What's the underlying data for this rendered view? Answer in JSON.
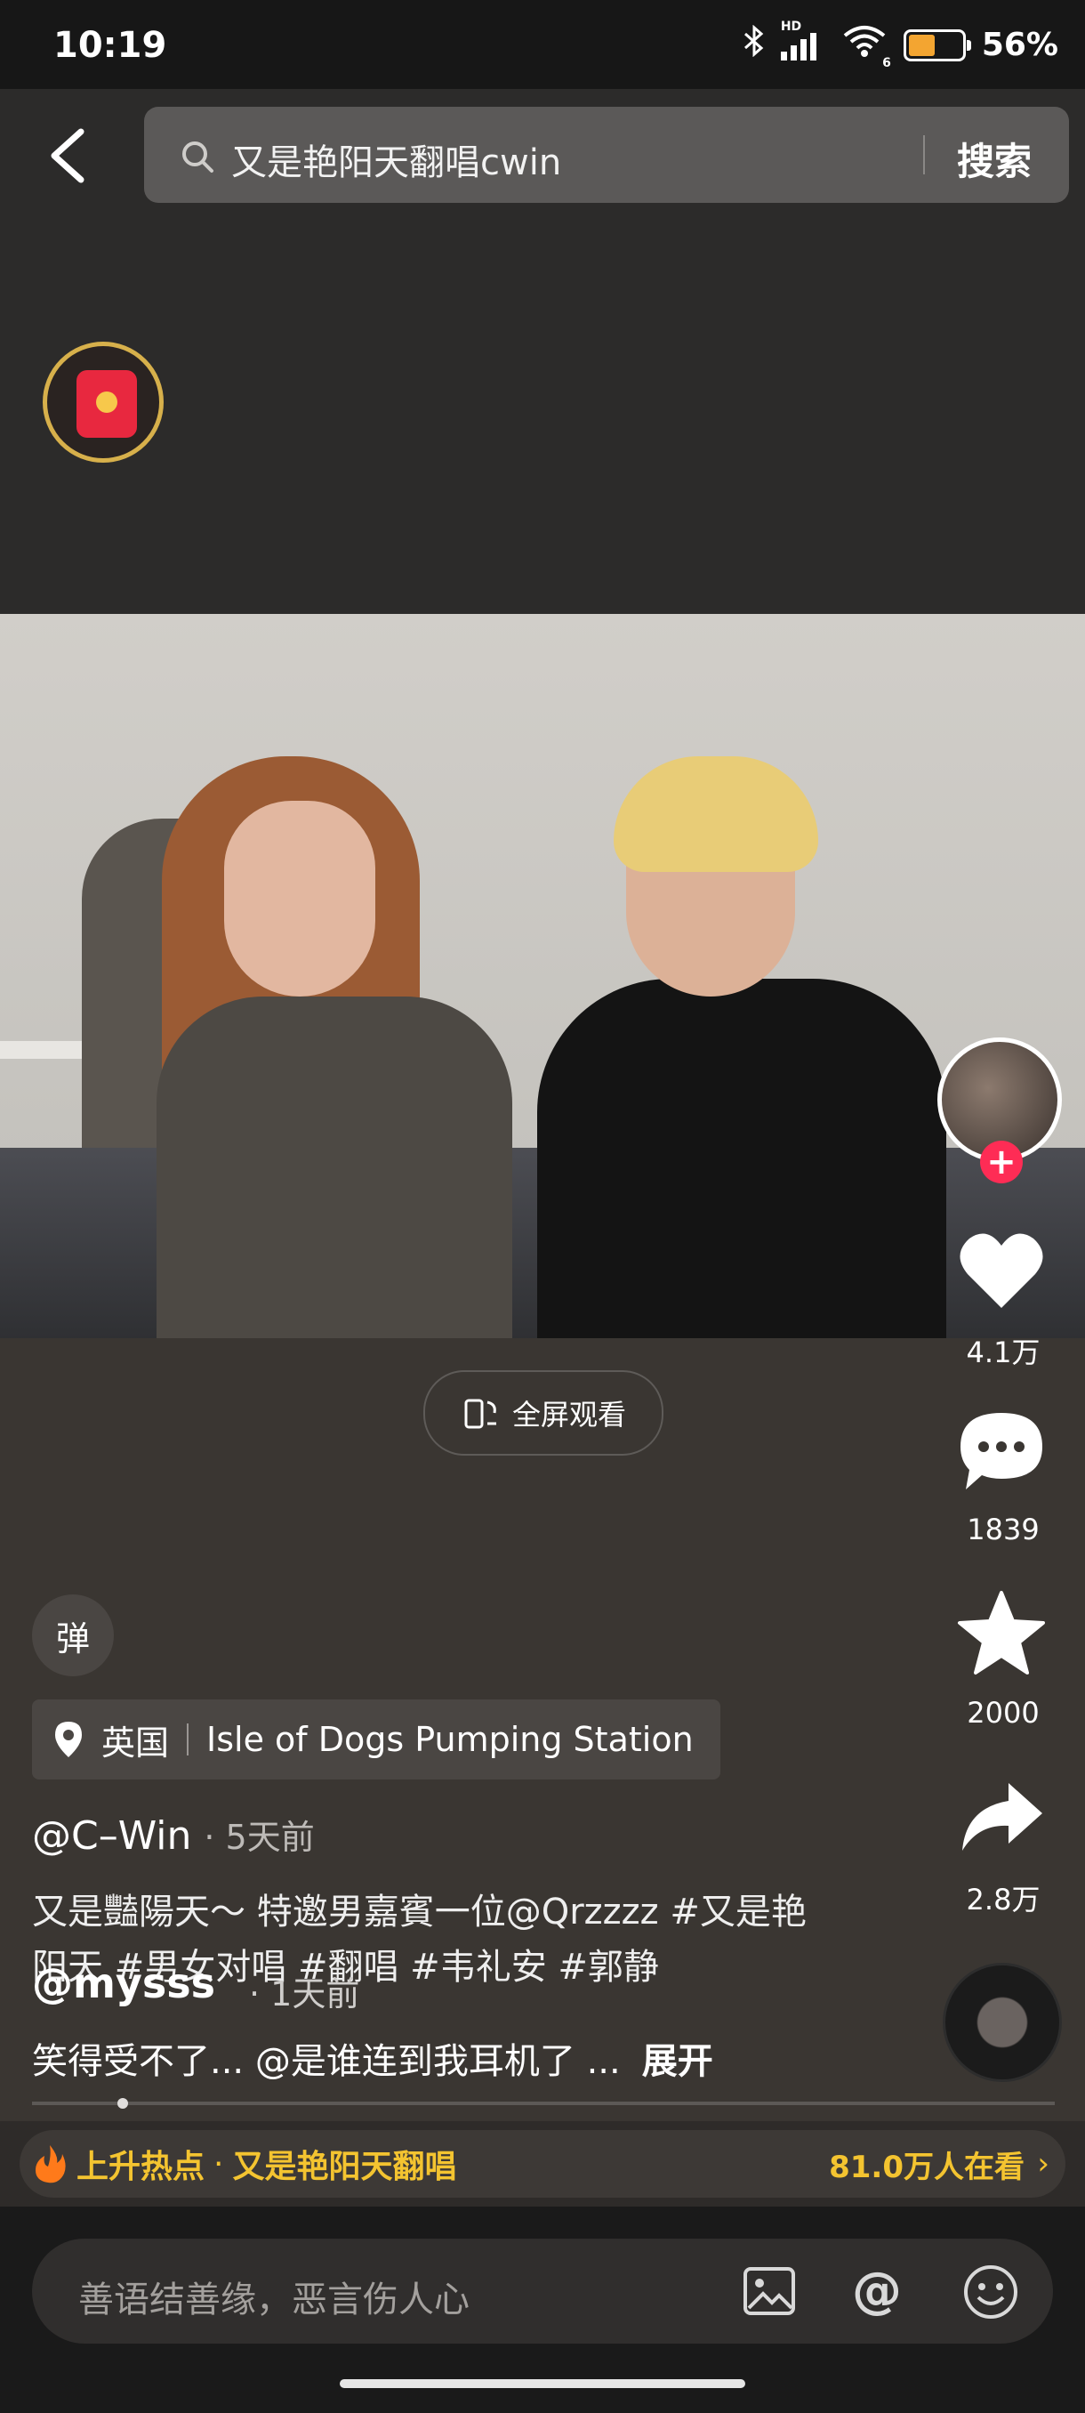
{
  "status_bar": {
    "time": "10:19",
    "network_label": "HD",
    "wifi_label": "6",
    "battery_percent": "56%",
    "battery_level": 0.56
  },
  "search": {
    "query": "又是艳阳天翻唱cwin",
    "button_label": "搜索"
  },
  "video": {
    "fullscreen_label": "全屏观看"
  },
  "actions": {
    "like_count": "4.1万",
    "comment_count": "1839",
    "favorite_count": "2000",
    "share_count": "2.8万"
  },
  "danmaku_label": "弹",
  "location": {
    "country": "英国",
    "place": "Isle of Dogs Pumping Station"
  },
  "post": {
    "author": "@C–Win",
    "time": "· 5天前",
    "caption": "又是豔陽天～ 特邀男嘉賓一位@Qrzzzz #又是艳阳天 #男女对唱 #翻唱 #韦礼安 #郭静"
  },
  "reply": {
    "user": "@mysss",
    "time": "· 1天前",
    "text": "笑得受不了... @是谁连到我耳机了 ...",
    "expand_label": "展开"
  },
  "hot": {
    "label": "上升热点",
    "dot": "·",
    "title": "又是艳阳天翻唱",
    "viewers": "81.0万人在看",
    "chevron": "›"
  },
  "comment_input": {
    "placeholder": "善语结善缘，恶言伤人心"
  },
  "colors": {
    "accent": "#fe2c55",
    "hot": "#f4c430",
    "battery": "#f3a531"
  },
  "icons": [
    "back-icon",
    "search-icon",
    "red-packet-icon",
    "fullscreen-icon",
    "heart-icon",
    "comment-icon",
    "star-icon",
    "share-icon",
    "location-icon",
    "fire-icon",
    "image-icon",
    "at-icon",
    "emoji-icon"
  ]
}
